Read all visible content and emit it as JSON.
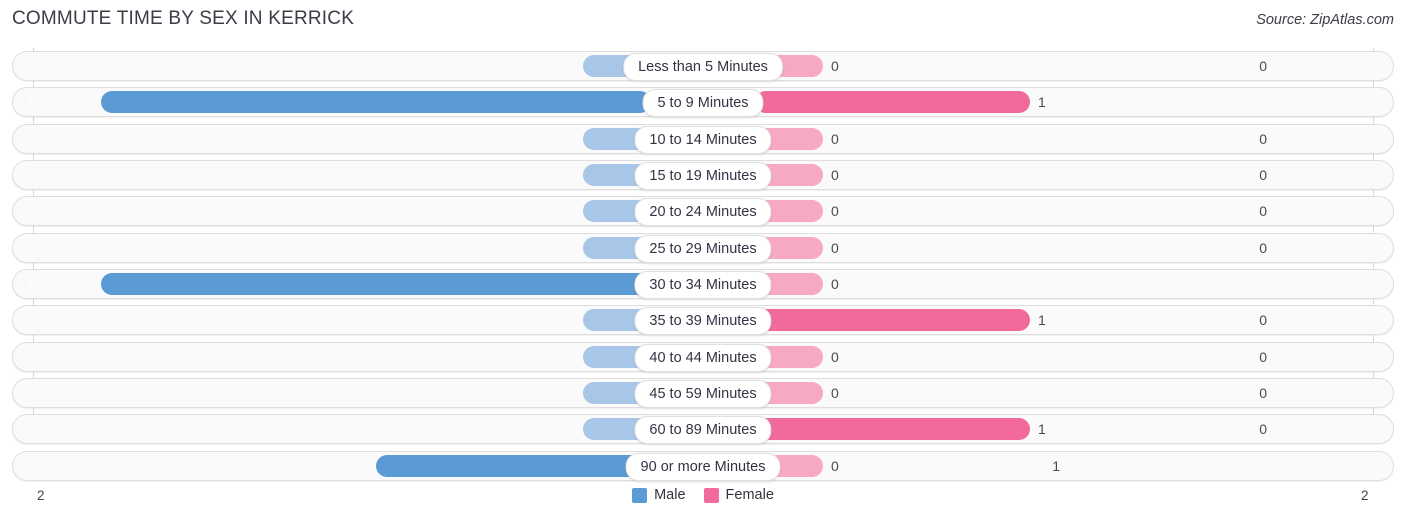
{
  "header": {
    "title": "COMMUTE TIME BY SEX IN KERRICK",
    "source": "Source: ZipAtlas.com"
  },
  "legend": {
    "male_label": "Male",
    "female_label": "Female",
    "male_color": "#5b9bd5",
    "female_color": "#f2699c"
  },
  "axis": {
    "left_label": "2",
    "right_label": "2"
  },
  "colors": {
    "male_strong": "#5b9bd5",
    "male_faint": "#a8c6e8",
    "female_strong": "#f2699c",
    "female_faint": "#f7a8c4",
    "track": "#fafafa",
    "track_border": "#dedede"
  },
  "chart_data": {
    "type": "bar",
    "orientation": "horizontal-diverging",
    "title": "COMMUTE TIME BY SEX IN KERRICK",
    "xlabel": "",
    "ylabel": "",
    "axis_max": 2,
    "xlim": [
      2,
      2
    ],
    "grid": true,
    "legend_position": "bottom-center",
    "categories": [
      "Less than 5 Minutes",
      "5 to 9 Minutes",
      "10 to 14 Minutes",
      "15 to 19 Minutes",
      "20 to 24 Minutes",
      "25 to 29 Minutes",
      "30 to 34 Minutes",
      "35 to 39 Minutes",
      "40 to 44 Minutes",
      "45 to 59 Minutes",
      "60 to 89 Minutes",
      "90 or more Minutes"
    ],
    "series": [
      {
        "name": "Male",
        "color": "#5b9bd5",
        "values": [
          0,
          2,
          0,
          0,
          0,
          0,
          2,
          0,
          0,
          0,
          0,
          1
        ],
        "labels": [
          "0",
          "2",
          "0",
          "0",
          "0",
          "0",
          "2",
          "0",
          "0",
          "0",
          "0",
          "1"
        ]
      },
      {
        "name": "Female",
        "color": "#f2699c",
        "values": [
          0,
          1,
          0,
          0,
          0,
          0,
          0,
          1,
          0,
          0,
          1,
          0
        ],
        "labels": [
          "0",
          "1",
          "0",
          "0",
          "0",
          "0",
          "0",
          "1",
          "0",
          "0",
          "1",
          "0"
        ]
      }
    ]
  }
}
